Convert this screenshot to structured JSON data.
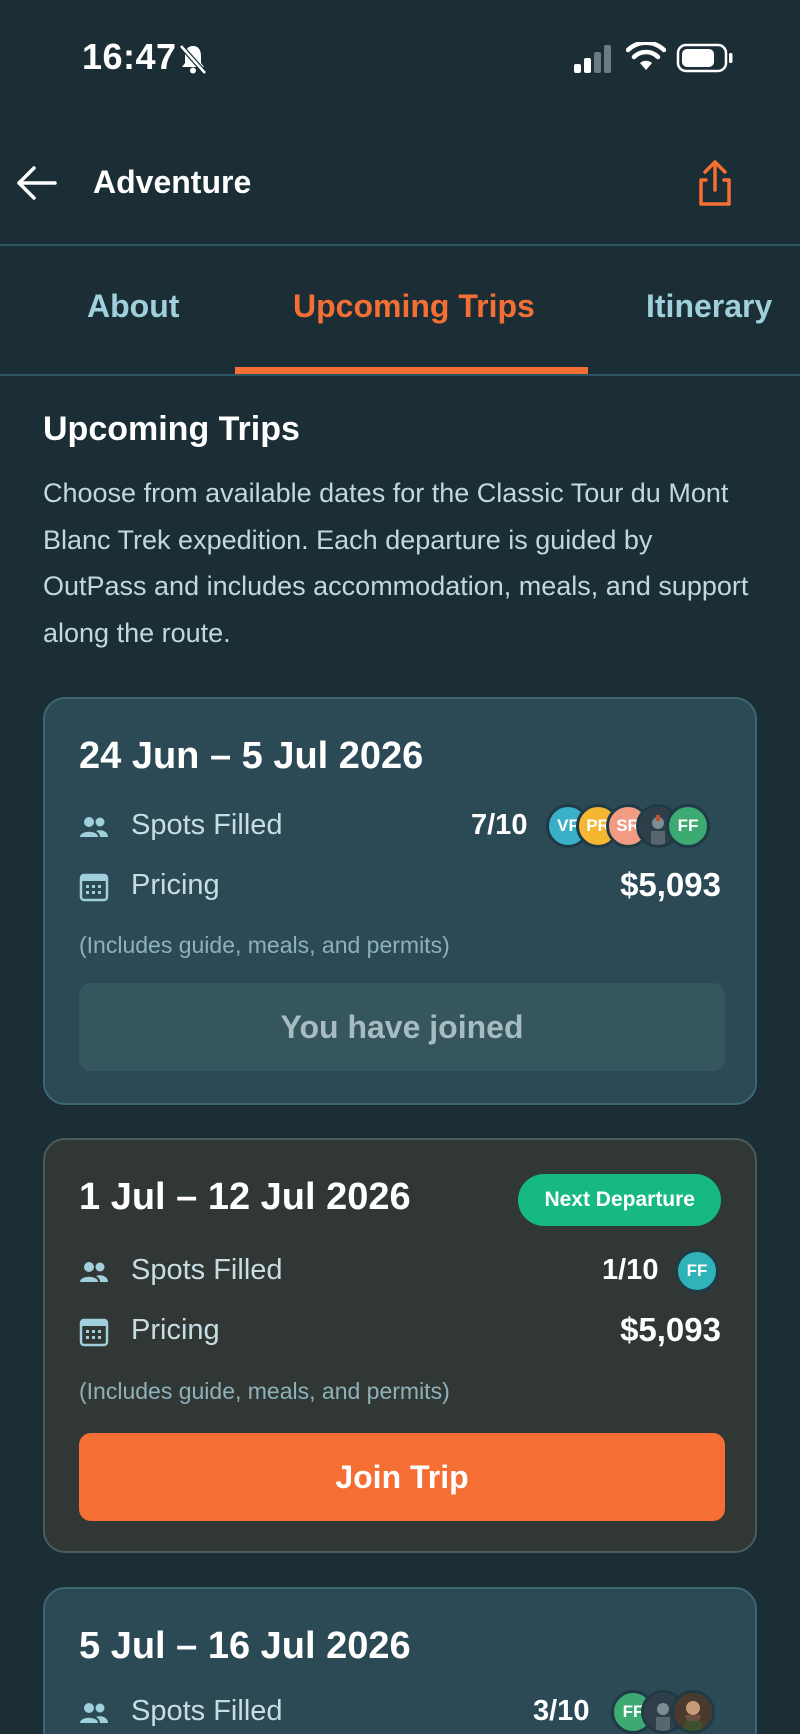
{
  "status_bar": {
    "time": "16:47",
    "icons": [
      "bell-muted-icon",
      "signal-icon",
      "wifi-icon",
      "battery-icon"
    ]
  },
  "header": {
    "title": "Adventure",
    "back_icon": "arrow-left-icon",
    "share_icon": "share-icon"
  },
  "tabs": [
    {
      "label": "About",
      "active": false
    },
    {
      "label": "Upcoming Trips",
      "active": true
    },
    {
      "label": "Itinerary",
      "active": false
    }
  ],
  "intro": {
    "title": "Upcoming Trips",
    "description": "Choose from available dates for the Classic Tour du Mont Blanc Trek expedition. Each departure is guided by OutPass and includes accommodation, meals, and support along the route."
  },
  "labels": {
    "spots": "Spots Filled",
    "pricing": "Pricing",
    "includes": "(Includes guide, meals, and permits)"
  },
  "trips": [
    {
      "dates": "24 Jun – 5 Jul 2026",
      "spots": "7/10",
      "price": "$5,093",
      "action": "You have joined",
      "avatars": [
        {
          "initials": "VF",
          "color": "#3ab0c8"
        },
        {
          "initials": "PR",
          "color": "#f5b731"
        },
        {
          "initials": "SR",
          "color": "#f09b82"
        },
        {
          "initials": "",
          "color": "#3b4d5a"
        },
        {
          "initials": "FF",
          "color": "#3daa72"
        }
      ]
    },
    {
      "dates": "1 Jul – 12 Jul 2026",
      "badge": "Next Departure",
      "spots": "1/10",
      "price": "$5,093",
      "action": "Join Trip",
      "avatars": [
        {
          "initials": "FF",
          "color": "#2fb3b8"
        }
      ]
    },
    {
      "dates": "5 Jul – 16 Jul 2026",
      "spots": "3/10",
      "avatars": [
        {
          "initials": "FF",
          "color": "#3daa72"
        },
        {
          "initials": "",
          "color": "#3b4d5a"
        },
        {
          "initials": "",
          "color": "#5a4a3c"
        }
      ]
    }
  ],
  "colors": {
    "background": "#1b2e35",
    "accent": "#f56f34",
    "badge": "#16b981"
  }
}
